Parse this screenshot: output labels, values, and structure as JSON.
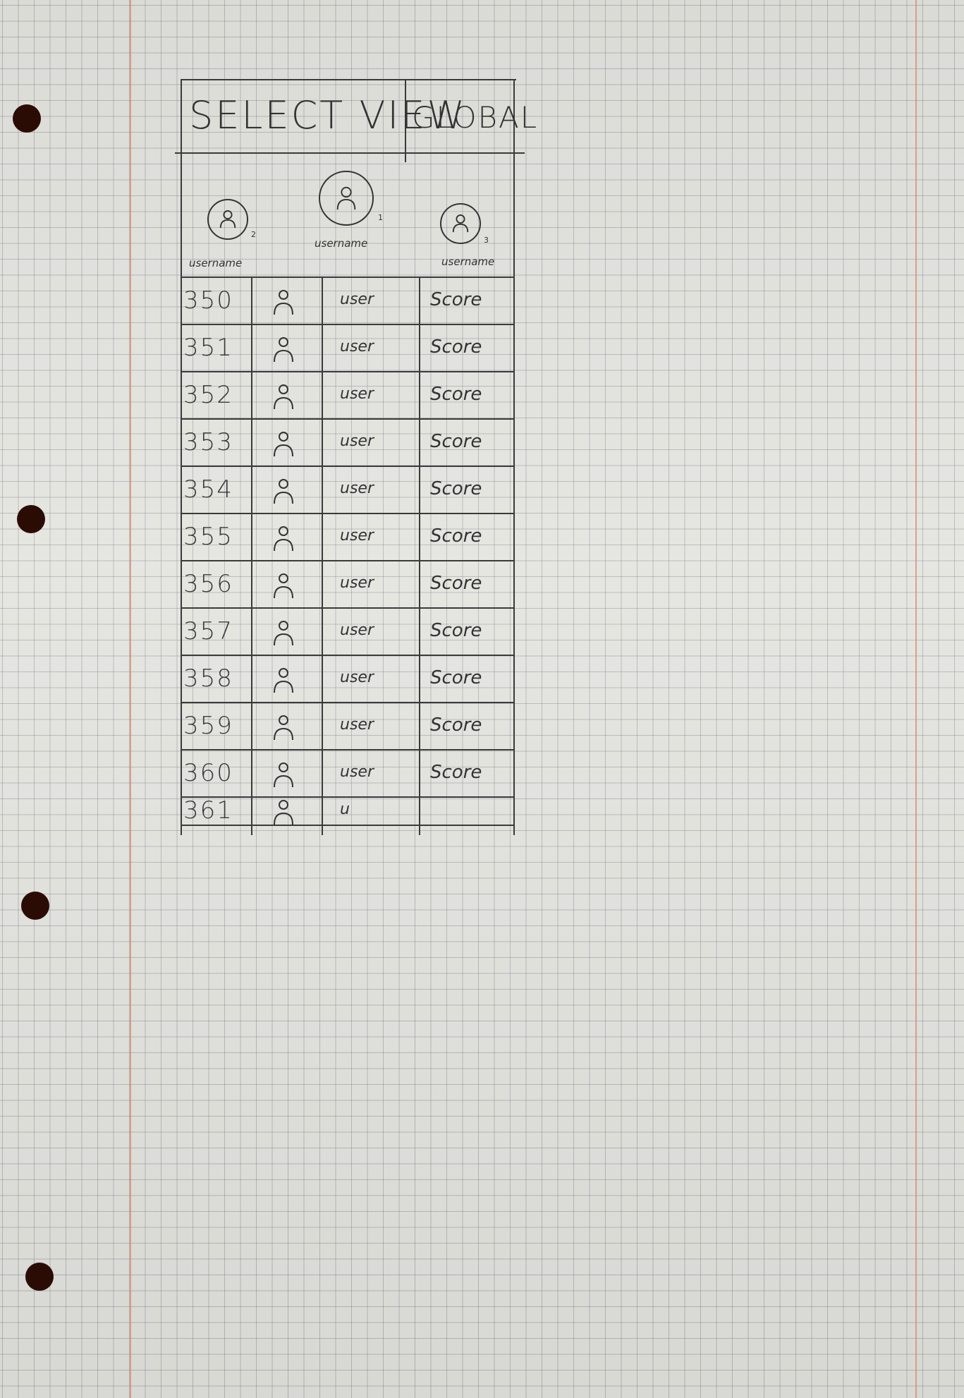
{
  "wireframe": {
    "title": "SELECT VIEW",
    "toggle_label": "GLOBAL",
    "podium": [
      {
        "rank": "2",
        "name": "username",
        "icon": "user-icon"
      },
      {
        "rank": "1",
        "name": "username",
        "icon": "user-icon"
      },
      {
        "rank": "3",
        "name": "username",
        "icon": "user-icon"
      }
    ],
    "rows": [
      {
        "rank": "350",
        "user": "user",
        "score": "Score"
      },
      {
        "rank": "351",
        "user": "user",
        "score": "Score"
      },
      {
        "rank": "352",
        "user": "user",
        "score": "Score"
      },
      {
        "rank": "353",
        "user": "user",
        "score": "Score"
      },
      {
        "rank": "354",
        "user": "user",
        "score": "Score"
      },
      {
        "rank": "355",
        "user": "user",
        "score": "Score"
      },
      {
        "rank": "356",
        "user": "user",
        "score": "Score"
      },
      {
        "rank": "357",
        "user": "user",
        "score": "Score"
      },
      {
        "rank": "358",
        "user": "user",
        "score": "Score"
      },
      {
        "rank": "359",
        "user": "user",
        "score": "Score"
      },
      {
        "rank": "360",
        "user": "user",
        "score": "Score"
      },
      {
        "rank": "361",
        "user": "u",
        "score": ""
      }
    ]
  }
}
